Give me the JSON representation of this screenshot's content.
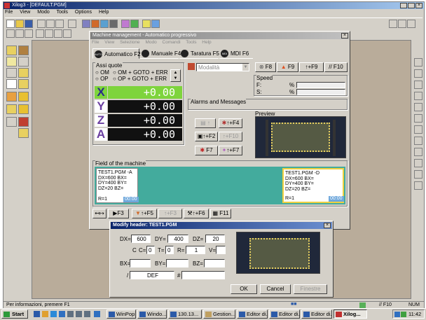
{
  "app": {
    "title": "Xilog3 - [DEFAULT.PGM]",
    "menu": [
      "File",
      "View",
      "Modo",
      "Tools",
      "Options",
      "Help"
    ]
  },
  "mm": {
    "title": "Machine management - Automatico progressivo",
    "menu": [
      "File",
      "View",
      "Selezione",
      "Modo",
      "Comandi",
      "Tools",
      "Help"
    ],
    "tabs": [
      {
        "label": "Automatico F2",
        "icon": "AUTO"
      },
      {
        "label": "Manuale F4",
        "icon": ""
      },
      {
        "label": "Taratura F5",
        "icon": ""
      },
      {
        "label": "MDI F6",
        "icon": "MDI"
      }
    ],
    "axes_title": "Assi quote",
    "radio1": {
      "a": "OM",
      "b": "OM + GOTO + ERR"
    },
    "radio2": {
      "a": "OP",
      "b": "OP + GOTO + ERR"
    },
    "axes": [
      {
        "name": "X",
        "value": "+0.00"
      },
      {
        "name": "Y",
        "value": "+0.00"
      },
      {
        "name": "Z",
        "value": "+0.00"
      },
      {
        "name": "A",
        "value": "+0.00"
      }
    ],
    "combo_value": "Modalità",
    "f8": "F8",
    "f9": "F9",
    "f9b": "↑+F9",
    "f10b": "// F10",
    "speed_title": "Speed",
    "speed_f": "F:",
    "speed_s": "S:",
    "pct": "%",
    "alarms_title": "Alarms and Messages",
    "ctrl": {
      "f4": "↑+F4",
      "f2": "↑+F2",
      "f10": "↑+F10",
      "f7": "F7",
      "f7b": "↑+F7"
    },
    "preview_title": "Preview",
    "field_title": "Field of the machine",
    "card_a": {
      "lines": [
        "TEST1.PGM  -A",
        "DX=600 BX=",
        "DY=400 BY=",
        "DZ=20 BZ="
      ],
      "r": "R=1",
      "time": "00:00"
    },
    "card_d": {
      "lines": [
        "TEST1.PGM  -D",
        "DX=600 BX=",
        "DY=400 BY=",
        "DZ=20 BZ="
      ],
      "r": "R=1",
      "time": "00:00"
    },
    "bot": {
      "f3": "F3",
      "f5": "↑+F5",
      "f3b": "↑+F3",
      "f6": "↑+F6",
      "f11": "F11"
    }
  },
  "dlg": {
    "title": "Modify header: TEST1.PGM",
    "dx_l": "DX=",
    "dx": "600",
    "dy_l": "DY=",
    "dy": "400",
    "dz_l": "DZ=",
    "dz": "20",
    "c": "C",
    "c_l": "C=",
    "c_v": "0",
    "t_l": "T=",
    "t_v": "0",
    "r_l": "R=",
    "r_v": "1",
    "v_l": "V=",
    "v_v": "",
    "bx_l": "BX=",
    "by_l": "BY=",
    "bz_l": "BZ=",
    "slash": "/",
    "def": "DEF",
    "hash": "#",
    "ok": "OK",
    "cancel": "Cancel",
    "help": "Finestre"
  },
  "status": {
    "text": "Per informazioni, premere F1",
    "dots": "■■",
    "f10": "// F10",
    "num": "NUM"
  },
  "taskbar": {
    "start": "Start",
    "items": [
      "WinPop...",
      "Windo...",
      "130.13...",
      "Gestion...",
      "Editor di...",
      "Editor di...",
      "Editor di...",
      "Xilog..."
    ],
    "clock": "11:42"
  },
  "colors": {
    "titlebar": "#0a246a",
    "titlebar2": "#a6caf0",
    "bg": "#d4d0c8",
    "teal": "#43ab9d",
    "green": "#7ed43c",
    "purple": "#6b3fa0",
    "preview": "#20283a"
  }
}
